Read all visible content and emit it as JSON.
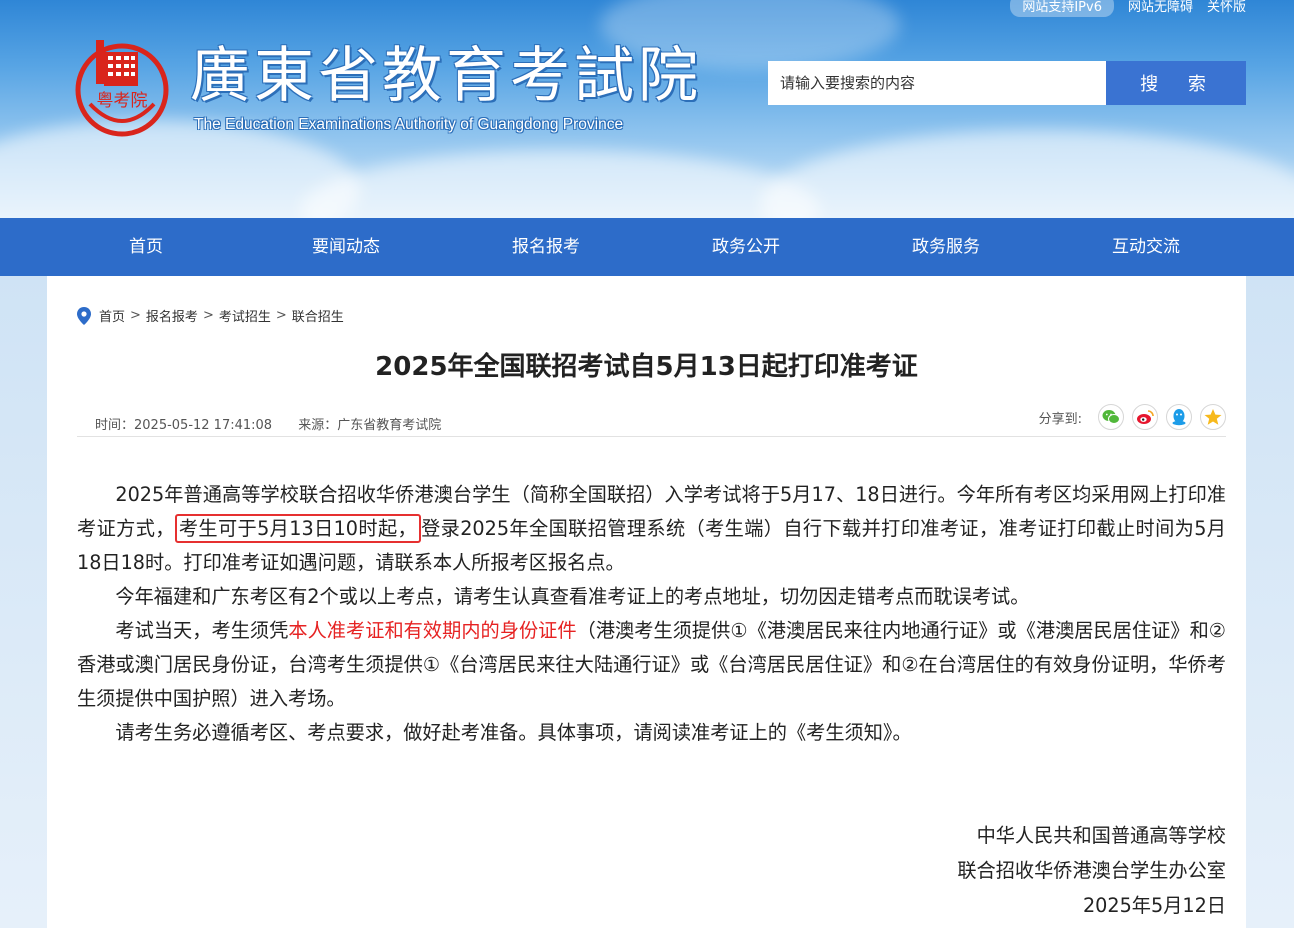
{
  "header": {
    "top_links": [
      "网站支持IPv6",
      "网站无障碍",
      "关怀版"
    ],
    "site_title": "廣東省教育考試院",
    "site_subtitle": "The Education Examinations Authority of Guangdong Province",
    "logo_text": "粤考院",
    "search": {
      "placeholder": "请输入要搜索的内容",
      "button_label": "搜 索"
    }
  },
  "nav": {
    "items": [
      "首页",
      "要闻动态",
      "报名报考",
      "政务公开",
      "政务服务",
      "互动交流"
    ]
  },
  "breadcrumb": {
    "items": [
      "首页",
      "报名报考",
      "考试招生",
      "联合招生"
    ],
    "separator": ">"
  },
  "article": {
    "title": "2025年全国联招考试自5月13日起打印准考证",
    "time_label": "时间：2025-05-12 17:41:08",
    "source_label": "来源：广东省教育考试院",
    "share_label": "分享到:",
    "share_icons": [
      "wechat-icon",
      "weibo-icon",
      "qq-icon",
      "qzone-icon"
    ],
    "paragraphs": {
      "p1_before": "2025年普通高等学校联合招收华侨港澳台学生（简称全国联招）入学考试将于5月17、18日进行。今年所有考区均采用网上打印准考证方式，",
      "p1_boxed": "考生可于5月13日10时起，",
      "p1_after": "登录2025年全国联招管理系统（考生端）自行下载并打印准考证，准考证打印截止时间为5月18日18时。打印准考证如遇问题，请联系本人所报考区报名点。",
      "p2": "今年福建和广东考区有2个或以上考点，请考生认真查看准考证上的考点地址，切勿因走错考点而耽误考试。",
      "p3_before": "考试当天，考生须凭",
      "p3_red": "本人准考证和有效期内的身份证件",
      "p3_after": "（港澳考生须提供①《港澳居民来往内地通行证》或《港澳居民居住证》和②香港或澳门居民身份证，台湾考生须提供①《台湾居民来往大陆通行证》或《台湾居民居住证》和②在台湾居住的有效身份证明，华侨考生须提供中国护照）进入考场。",
      "p4": "请考生务必遵循考区、考点要求，做好赴考准备。具体事项，请阅读准考证上的《考生须知》。"
    },
    "signoff": [
      "中华人民共和国普通高等学校",
      "联合招收华侨港澳台学生办公室",
      "2025年5月12日"
    ]
  },
  "colors": {
    "nav_bg": "#2d6cc9",
    "search_button": "#3a73d2",
    "highlight_red": "#e62222",
    "logo_red": "#d9251c"
  }
}
